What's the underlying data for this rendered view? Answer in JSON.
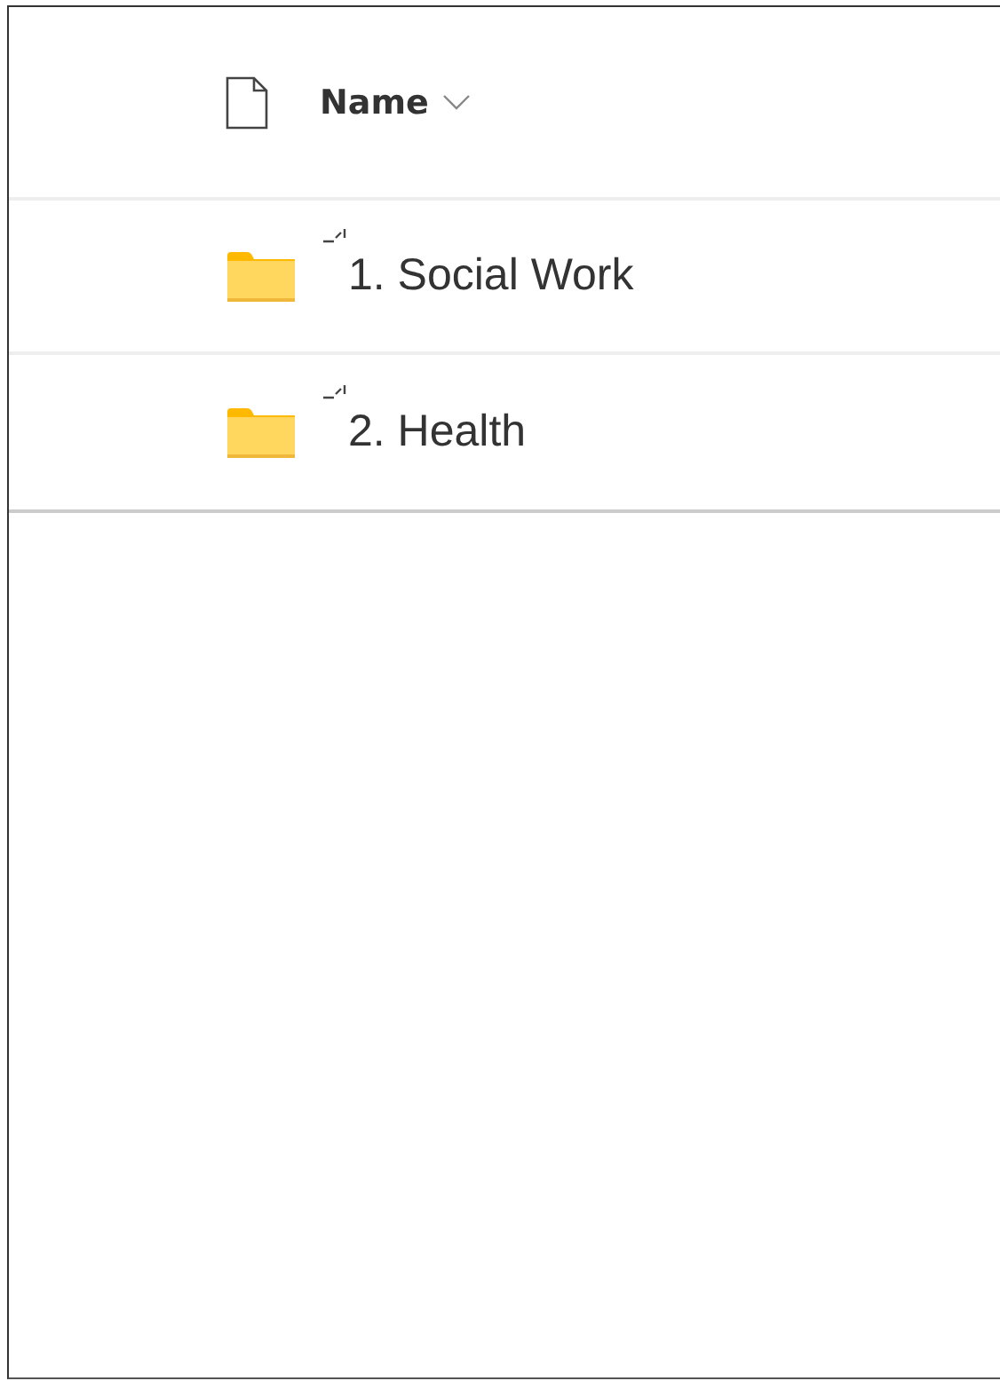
{
  "header": {
    "column": "Name"
  },
  "rows": [
    {
      "name": "1. Social Work",
      "new": true
    },
    {
      "name": "2. Health",
      "new": true
    }
  ]
}
